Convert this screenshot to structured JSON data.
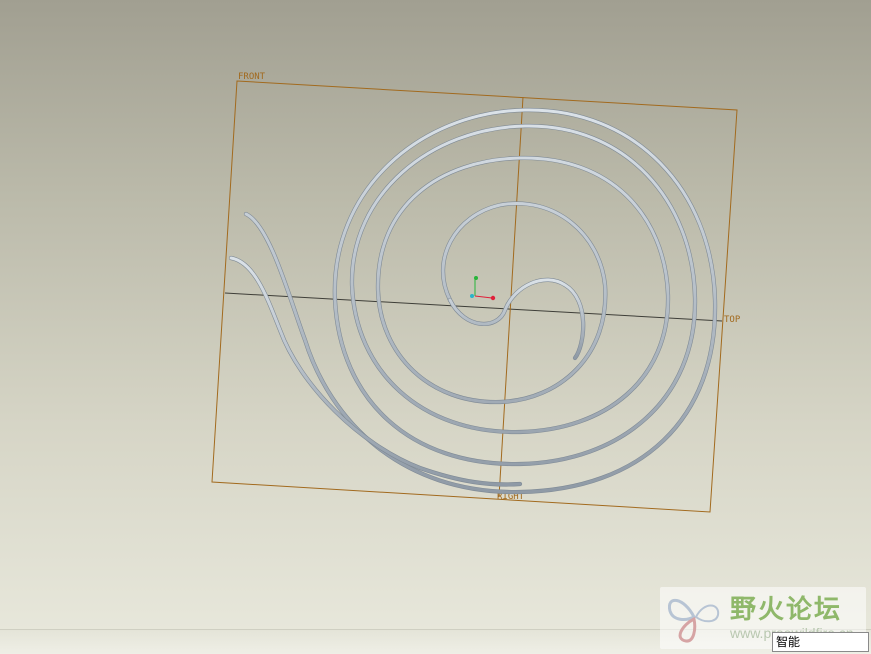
{
  "datum_planes": {
    "front_label": "FRONT",
    "top_label": "TOP",
    "right_label": "RIGHT"
  },
  "watermark": {
    "title": "野火论坛",
    "url": "www.proewildfire.cn"
  },
  "status_bar": {
    "selection_filter": "智能"
  },
  "colors": {
    "datum_plane": "#a26a1e",
    "spiral_tube": "#b9c4cd",
    "axis_x": "#e0203a",
    "axis_y": "#27b53a",
    "axis_z": "#2cb3c9"
  }
}
